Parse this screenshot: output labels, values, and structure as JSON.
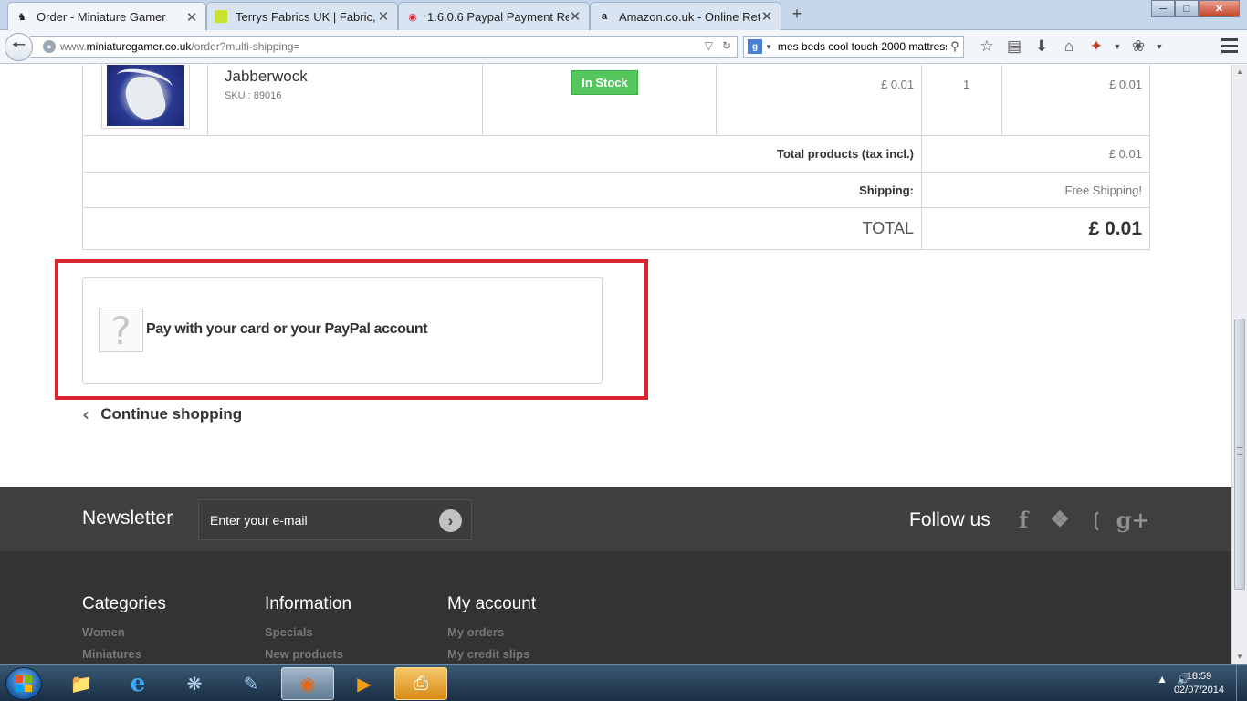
{
  "browser": {
    "tabs": [
      {
        "label": "Order - Miniature Gamer",
        "active": true
      },
      {
        "label": "Terrys Fabrics UK | Fabric, ...",
        "active": false
      },
      {
        "label": "1.6.0.6 Paypal Payment Ret...",
        "active": false
      },
      {
        "label": "Amazon.co.uk - Online Ret...",
        "active": false
      }
    ],
    "new_tab": "+",
    "url_prefix": "www.",
    "url_host": "miniaturegamer.co.uk",
    "url_path": "/order?multi-shipping=",
    "search_value": "mes beds cool touch 2000 mattress",
    "search_engine_letter": "g"
  },
  "cart": {
    "product": {
      "name": "Jabberwock",
      "sku": "SKU : 89016",
      "availability": "In Stock",
      "unit_price": "£ 0.01",
      "quantity": "1",
      "total": "£ 0.01"
    },
    "summary": {
      "total_products_label": "Total products (tax incl.)",
      "total_products_value": "£ 0.01",
      "shipping_label": "Shipping:",
      "shipping_value": "Free Shipping!",
      "total_label": "TOTAL",
      "total_value": "£ 0.01"
    }
  },
  "payment": {
    "option_label": "Pay with your card or your PayPal account",
    "icon_glyph": "?"
  },
  "continue_shopping": "Continue shopping",
  "newsletter": {
    "title": "Newsletter",
    "placeholder": "Enter your e-mail",
    "follow_title": "Follow us",
    "social": [
      "facebook",
      "twitter",
      "rss",
      "google-plus"
    ]
  },
  "footer": {
    "columns": [
      {
        "title": "Categories",
        "links": [
          "Women",
          "Miniatures"
        ]
      },
      {
        "title": "Information",
        "links": [
          "Specials",
          "New products"
        ]
      },
      {
        "title": "My account",
        "links": [
          "My orders",
          "My credit slips"
        ]
      }
    ]
  },
  "taskbar": {
    "time": "18:59",
    "date": "02/07/2014"
  },
  "colors": {
    "in_stock": "#55c65e",
    "highlight_border": "#d9252f",
    "footer_band": "#3f3f3f",
    "footer": "#333333"
  }
}
